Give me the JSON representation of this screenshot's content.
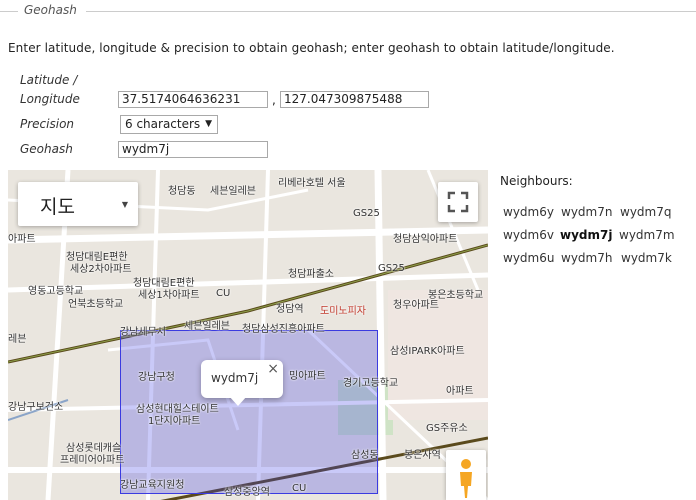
{
  "section": {
    "legend": "Geohash"
  },
  "intro": "Enter latitude, longitude & precision to obtain geohash; enter geohash to obtain latitude/longitude.",
  "form": {
    "latlon_label_line1": "Latitude /",
    "latlon_label_line2": "Longitude",
    "latitude": "37.5174064636231",
    "separator": ",",
    "longitude": "127.047309875488",
    "precision_label": "Precision",
    "precision_value": "6 characters",
    "geohash_label": "Geohash",
    "geohash_value": "wydm7j"
  },
  "map": {
    "map_type": "지도",
    "infowindow_text": "wydm7j",
    "highlight_color": "#3b3be0",
    "labels": [
      "청담동",
      "세븐일레븐",
      "리베라호텔 서울",
      "GS25",
      "청담삼익아파트",
      "청담대림E편한",
      "세상2차아파트",
      "영동고등학교",
      "언북초등학교",
      "청담대림E편한",
      "세상1차아파트",
      "청담파출소",
      "GS25",
      "봉은초등학교",
      "CU",
      "청담역",
      "도미노피자",
      "청우아파트",
      "강남세무서",
      "세븐일레븐",
      "청담삼성진흥아파트",
      "삼성IPARK아파트",
      "강남구청",
      "밍아파트",
      "경기고등학교",
      "강남구보건소",
      "삼성현대힐스테이트",
      "1단지아파트",
      "GS주유소",
      "삼성롯데캐슬",
      "프레미어아파트",
      "삼성동",
      "봉은사역",
      "강남교육지원청",
      "삼성중앙역",
      "CU",
      "아파트",
      "레븐",
      "아파트",
      "성"
    ]
  },
  "neighbours": {
    "title": "Neighbours:",
    "cells": [
      "wydm6y",
      "wydm7n",
      "wydm7q",
      "wydm6v",
      "wydm7j",
      "wydm7m",
      "wydm6u",
      "wydm7h",
      "wydm7k"
    ]
  }
}
